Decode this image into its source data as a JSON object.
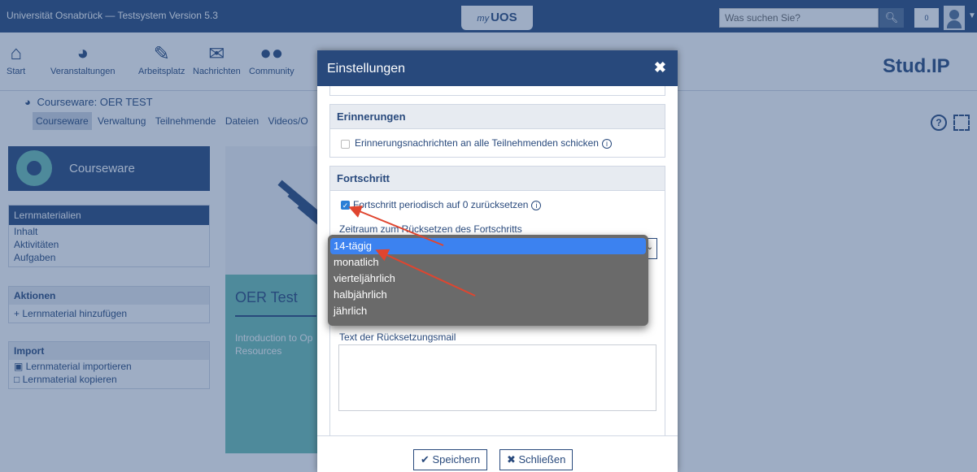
{
  "topbar": {
    "title": "Universität Osnabrück — Testsystem Version 5.3",
    "logo_prefix": "my",
    "logo_text": "UOS",
    "search_placeholder": "Was suchen Sie?",
    "notification_count": "0"
  },
  "nav": {
    "items": [
      {
        "label": "Start",
        "icon": "home-icon"
      },
      {
        "label": "Veranstaltungen",
        "icon": "courseware-icon"
      },
      {
        "label": "Arbeitsplatz",
        "icon": "edit-icon"
      },
      {
        "label": "Nachrichten",
        "icon": "mail-icon"
      },
      {
        "label": "Community",
        "icon": "community-icon"
      }
    ],
    "brand": "Stud.IP"
  },
  "context": {
    "title": "Courseware: OER TEST",
    "tabs": [
      "Courseware",
      "Verwaltung",
      "Teilnehmende",
      "Dateien",
      "Videos/O"
    ]
  },
  "sidebar": {
    "header": "Courseware",
    "nav_items": [
      "Lernmaterialien",
      "Inhalt",
      "Aktivitäten",
      "Aufgaben"
    ],
    "actions_title": "Aktionen",
    "actions": [
      "Lernmaterial hinzufügen"
    ],
    "import_title": "Import",
    "imports": [
      "Lernmaterial importieren",
      "Lernmaterial kopieren"
    ]
  },
  "course_tile": {
    "title": "OER Test",
    "description_line1": "Introduction to Op",
    "description_line2": "Resources"
  },
  "dialog": {
    "title": "Einstellungen",
    "reminder_legend": "Erinnerungen",
    "reminder_label": "Erinnerungsnachrichten an alle Teilnehmenden schicken",
    "reminder_checked": false,
    "progress_legend": "Fortschritt",
    "progress_reset_label": "Fortschritt periodisch auf 0 zurücksetzen",
    "progress_reset_checked": true,
    "period_label": "Zeitraum zum Rücksetzen des Fortschritts",
    "period_selected": "14-tägig",
    "reset_mail_label": "Text der Rücksetzungsmail",
    "reset_mail_value": "",
    "save_label": "Speichern",
    "close_label": "Schließen"
  },
  "dropdown": {
    "options": [
      "14-tägig",
      "monatlich",
      "vierteljährlich",
      "halbjährlich",
      "jährlich"
    ],
    "selected_index": 0
  },
  "colors": {
    "brand": "#28497c",
    "accent": "#6ec0b5",
    "selection": "#3c82f0",
    "annotation": "#e0452f"
  }
}
